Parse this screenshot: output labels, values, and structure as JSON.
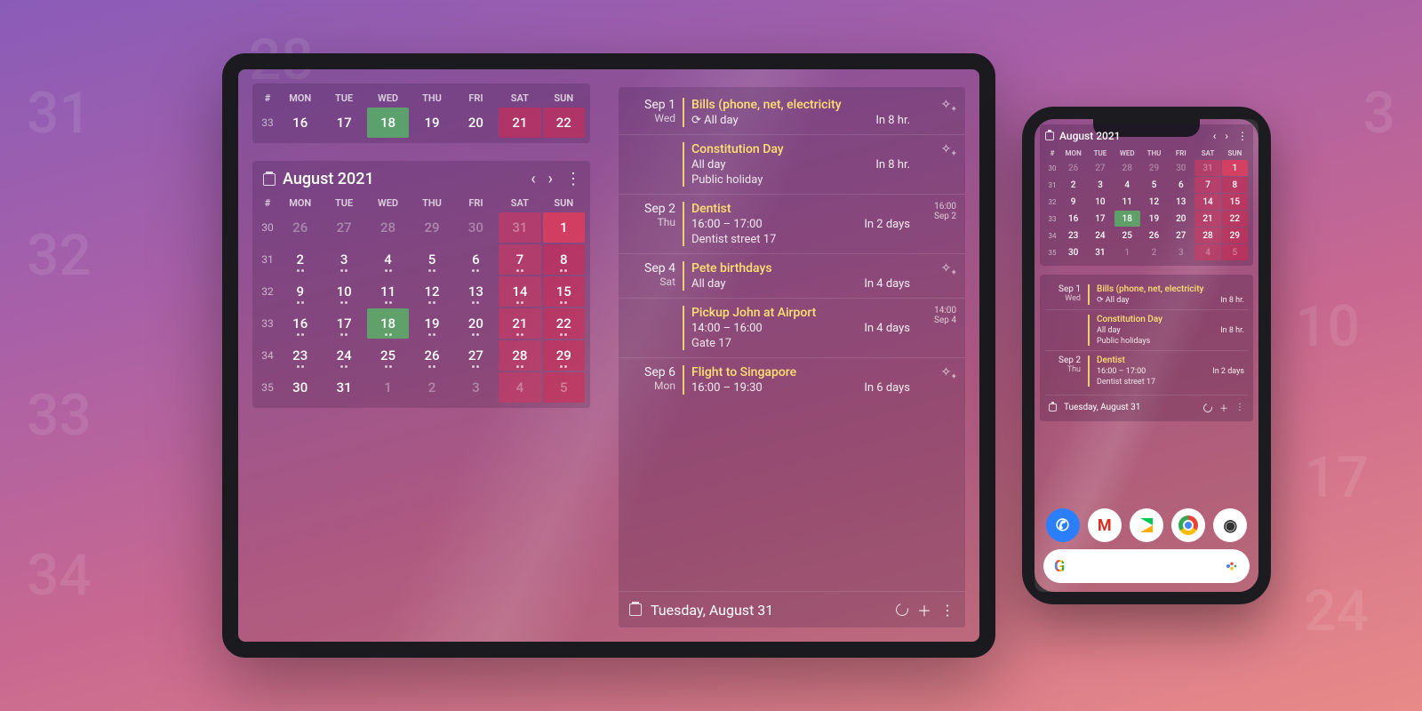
{
  "month_title": "August 2021",
  "day_headers": [
    "#",
    "MON",
    "TUE",
    "WED",
    "THU",
    "FRI",
    "SAT",
    "SUN"
  ],
  "week_row": {
    "week": "33",
    "days": [
      "16",
      "17",
      "18",
      "19",
      "20",
      "21",
      "22"
    ]
  },
  "full_month": {
    "weeks": [
      {
        "wk": "30",
        "d": [
          "26",
          "27",
          "28",
          "29",
          "30",
          "31",
          "1"
        ]
      },
      {
        "wk": "31",
        "d": [
          "2",
          "3",
          "4",
          "5",
          "6",
          "7",
          "8"
        ]
      },
      {
        "wk": "32",
        "d": [
          "9",
          "10",
          "11",
          "12",
          "13",
          "14",
          "15"
        ]
      },
      {
        "wk": "33",
        "d": [
          "16",
          "17",
          "18",
          "19",
          "20",
          "21",
          "22"
        ]
      },
      {
        "wk": "34",
        "d": [
          "23",
          "24",
          "25",
          "26",
          "27",
          "28",
          "29"
        ]
      },
      {
        "wk": "35",
        "d": [
          "30",
          "31",
          "1",
          "2",
          "3",
          "4",
          "5"
        ]
      }
    ]
  },
  "events": [
    {
      "date": "Sep 1",
      "dow": "Wed",
      "title": "Bills (phone, net, electricity",
      "time": "⟳ All day",
      "rel": "In 8 hr.",
      "meta": ""
    },
    {
      "date": "",
      "dow": "",
      "title": "Constitution Day",
      "time": "All day",
      "rel": "In 8 hr.",
      "sub": "Public holiday",
      "meta": ""
    },
    {
      "date": "Sep 2",
      "dow": "Thu",
      "title": "Dentist",
      "time": "16:00 – 17:00",
      "rel": "In 2 days",
      "sub": "Dentist street 17",
      "meta": "16:00\nSep 2"
    },
    {
      "date": "Sep 4",
      "dow": "Sat",
      "title": "Pete birthdays",
      "time": "All day",
      "rel": "In 4 days",
      "meta": ""
    },
    {
      "date": "",
      "dow": "",
      "title": "Pickup John at Airport",
      "time": "14:00 – 16:00",
      "rel": "In 4 days",
      "sub": "Gate 17",
      "meta": "14:00\nSep 4"
    },
    {
      "date": "Sep 6",
      "dow": "Mon",
      "title": "Flight to Singapore",
      "time": "16:00 – 19:30",
      "rel": "In 6 days",
      "meta": ""
    }
  ],
  "toolbar_date": "Tuesday, August 31",
  "phone_events": [
    {
      "date": "Sep 1",
      "dow": "Wed",
      "title": "Bills (phone, net, electricity",
      "time": "⟳ All day",
      "rel": "In 8 hr."
    },
    {
      "date": "",
      "dow": "",
      "title": "Constitution Day",
      "time": "All day",
      "rel": "In 8 hr.",
      "sub": "Public holidays"
    },
    {
      "date": "Sep 2",
      "dow": "Thu",
      "title": "Dentist",
      "time": "16:00 – 17:00",
      "rel": "In 2 days",
      "sub": "Dentist street 17"
    }
  ],
  "phone_toolbar_date": "Tuesday, August 31"
}
